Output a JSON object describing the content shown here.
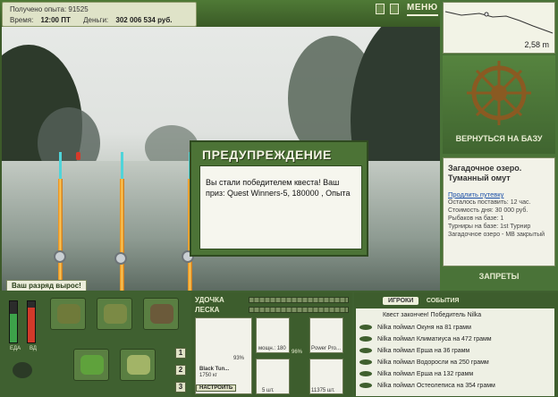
{
  "header": {
    "xp_label": "Получено опыта: 91525",
    "time_label": "Время:",
    "time_value": "12:00 ПТ",
    "money_label": "Деньги:",
    "money_value": "302 006 534 руб.",
    "menu_label": "МЕНЮ"
  },
  "map": {
    "depth": "2,58 m"
  },
  "scene": {
    "notice": "Ваш разряд вырос!"
  },
  "dialog": {
    "title": "ПРЕДУПРЕЖДЕНИЕ",
    "message": "Вы стали победителем квеста! Ваш приз: Quest Winners-5, 180000 , Опыта"
  },
  "right_panel": {
    "return_label": "ВЕРНУТЬСЯ НА БАЗУ",
    "location_title": "Загадочное озеро. Туманный омут",
    "extend_link": "Продлить путевку",
    "lines": [
      "Осталось поставить: 12 час.",
      "Стоимость дня: 30 000 руб.",
      "Рыбаков на базе: 1",
      "Турниры на базе: 1st Турнир",
      "Загадочное озеро - МВ закрытый"
    ],
    "bans_label": "ЗАПРЕТЫ"
  },
  "meters": {
    "food_label": "ЕДА",
    "drink_label": "ВД",
    "food_level": 0.7,
    "drink_level": 0.85
  },
  "hotbar": [
    "1",
    "2",
    "3"
  ],
  "tackle": {
    "rod_label": "УДОЧКА",
    "line_label": "ЛЕСКА",
    "rod_pct": "93%",
    "reel_pct": "96%",
    "rod_name": "Black Tun...",
    "rod_weight": "1750 кг",
    "reel_info": "мощн.: 180",
    "bait_name": "Power Pro...",
    "hook_count": "5 шт.",
    "line_count": "11375 шт.",
    "setup_label": "НАСТРОИТЬ"
  },
  "chat": {
    "tab_players": "ИГРОКИ",
    "tab_events": "СОБЫТИЯ",
    "header": "Квест закончен! Победитель Nilka",
    "events": [
      "Nilka поймал Окуня на 81 грамм",
      "Nilka поймал Климатиуса на 472 грамм",
      "Nilka поймал Ерша на 36 грамм",
      "Nilka поймал Водоросли на 250 грамм",
      "Nilka поймал Ерша на 132 грамм",
      "Nilka поймал Остеолеписа на 354 грамм"
    ]
  }
}
